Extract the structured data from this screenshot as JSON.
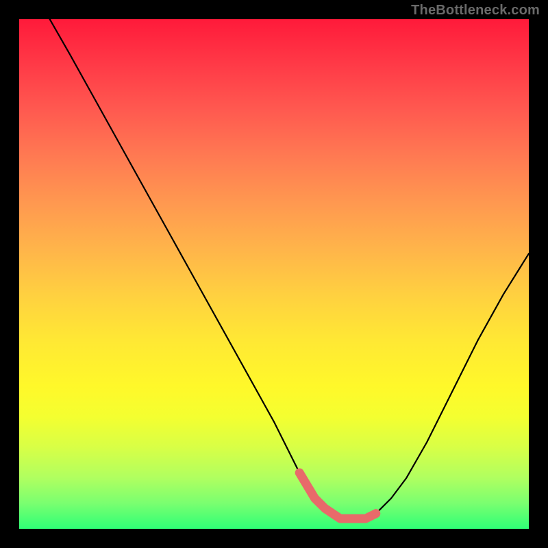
{
  "watermark": "TheBottleneck.com",
  "chart_data": {
    "type": "line",
    "title": "",
    "xlabel": "",
    "ylabel": "",
    "xlim": [
      0,
      100
    ],
    "ylim": [
      0,
      100
    ],
    "grid": false,
    "legend": false,
    "series": [
      {
        "name": "curve",
        "color": "#000000",
        "x": [
          6,
          10,
          15,
          20,
          25,
          30,
          35,
          40,
          45,
          50,
          53,
          55,
          58,
          60,
          63,
          66,
          68,
          70,
          73,
          76,
          80,
          85,
          90,
          95,
          100
        ],
        "values": [
          100,
          93,
          84,
          75,
          66,
          57,
          48,
          39,
          30,
          21,
          15,
          11,
          6,
          4,
          2,
          2,
          2,
          3,
          6,
          10,
          17,
          27,
          37,
          46,
          54
        ]
      }
    ],
    "markers": [
      {
        "name": "flat-segment",
        "color": "#e86a6a",
        "x_range": [
          55,
          72
        ],
        "y": 2
      }
    ],
    "gradient_background": {
      "direction": "vertical",
      "stops": [
        {
          "pos": 0.0,
          "color": "#ff1a3a"
        },
        {
          "pos": 0.5,
          "color": "#ffd040"
        },
        {
          "pos": 0.78,
          "color": "#f4ff30"
        },
        {
          "pos": 1.0,
          "color": "#2fff76"
        }
      ]
    }
  }
}
